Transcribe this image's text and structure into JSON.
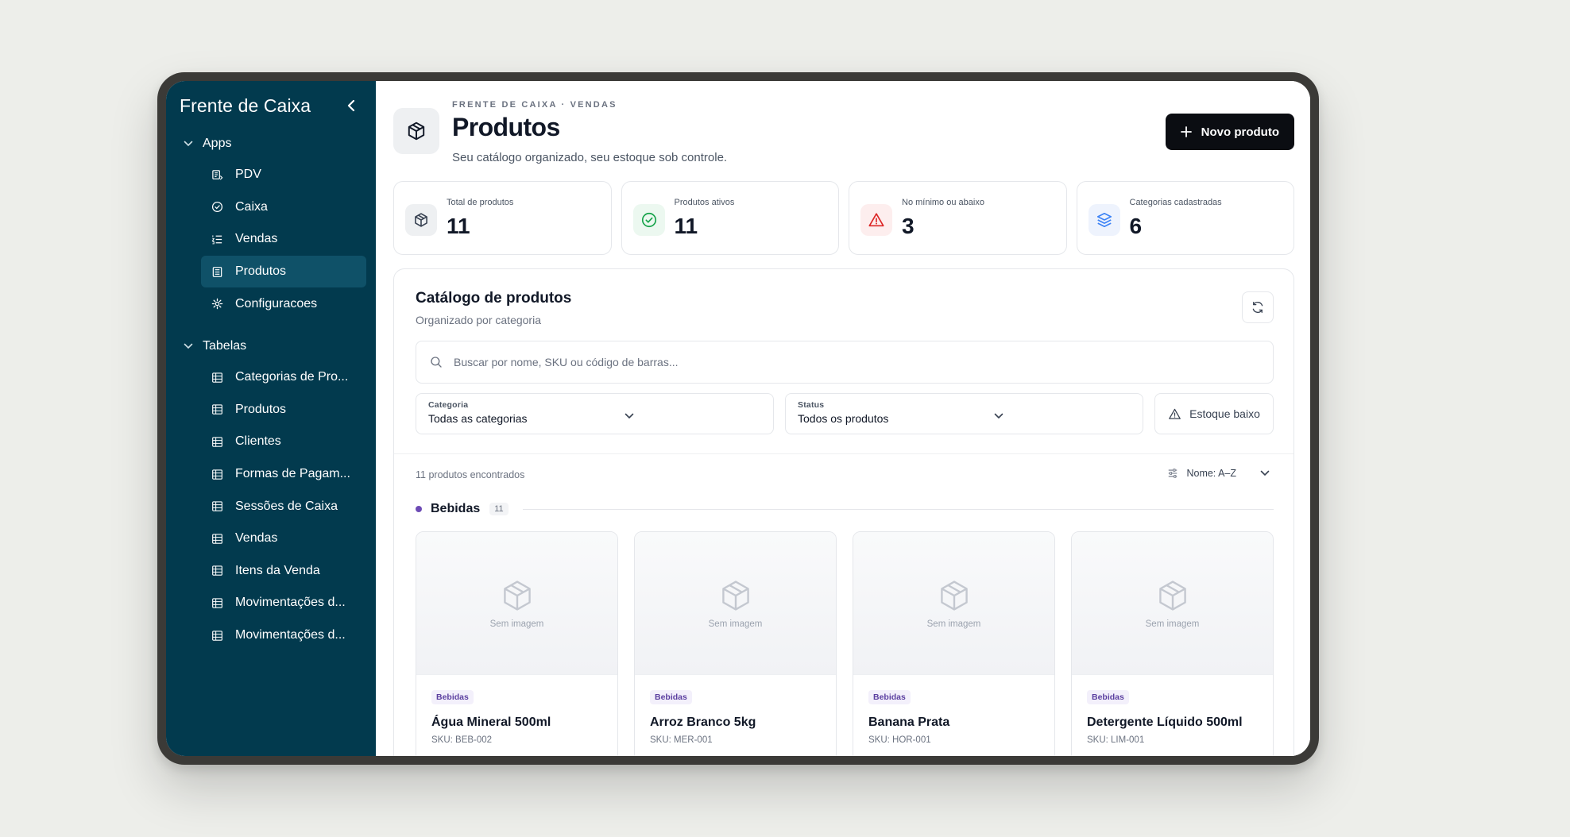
{
  "sidebar": {
    "brand": "Frente de Caixa",
    "groups": [
      {
        "label": "Apps",
        "items": [
          {
            "label": "PDV",
            "icon": "receipt-icon"
          },
          {
            "label": "Caixa",
            "icon": "check-circle-icon"
          },
          {
            "label": "Vendas",
            "icon": "list-ordered-icon"
          },
          {
            "label": "Produtos",
            "icon": "document-list-icon",
            "active": true
          },
          {
            "label": "Configuracoes",
            "icon": "gear-icon"
          }
        ]
      },
      {
        "label": "Tabelas",
        "items": [
          {
            "label": "Categorias de Pro...",
            "icon": "table-icon"
          },
          {
            "label": "Produtos",
            "icon": "table-icon"
          },
          {
            "label": "Clientes",
            "icon": "table-icon"
          },
          {
            "label": "Formas de Pagam...",
            "icon": "table-icon"
          },
          {
            "label": "Sessões de Caixa",
            "icon": "table-icon"
          },
          {
            "label": "Vendas",
            "icon": "table-icon"
          },
          {
            "label": "Itens da Venda",
            "icon": "table-icon"
          },
          {
            "label": "Movimentações d...",
            "icon": "table-icon"
          },
          {
            "label": "Movimentações d...",
            "icon": "table-icon"
          }
        ]
      }
    ]
  },
  "header": {
    "eyebrow": "FRENTE DE CAIXA · VENDAS",
    "title": "Produtos",
    "subtitle": "Seu catálogo organizado, seu estoque sob controle.",
    "new_button": "Novo produto"
  },
  "stats": [
    {
      "label": "Total de produtos",
      "value": "11",
      "icon": "package-icon",
      "color": "#374151",
      "bg": "#eef0f2"
    },
    {
      "label": "Produtos ativos",
      "value": "11",
      "icon": "check-circle-icon",
      "color": "#16a34a",
      "bg": "#ecf8f0"
    },
    {
      "label": "No mínimo ou abaixo",
      "value": "3",
      "icon": "warning-icon",
      "color": "#dc2626",
      "bg": "#fdeeee"
    },
    {
      "label": "Categorias cadastradas",
      "value": "6",
      "icon": "layers-icon",
      "color": "#3b82f6",
      "bg": "#eef3fd"
    }
  ],
  "catalog": {
    "title": "Catálogo de produtos",
    "subtitle": "Organizado por categoria",
    "search_placeholder": "Buscar por nome, SKU ou código de barras...",
    "filters": {
      "category_label": "Categoria",
      "category_value": "Todas as categorias",
      "status_label": "Status",
      "status_value": "Todos os produtos",
      "low_stock_button": "Estoque baixo"
    },
    "count_text": "11 produtos encontrados",
    "sort_text": "Nome: A–Z",
    "group": {
      "name": "Bebidas",
      "count": "11",
      "color": "#6d4bb5"
    },
    "no_image_text": "Sem imagem",
    "products": [
      {
        "category": "Bebidas",
        "name": "Água Mineral 500ml",
        "sku": "SKU: BEB-002"
      },
      {
        "category": "Bebidas",
        "name": "Arroz Branco 5kg",
        "sku": "SKU: MER-001"
      },
      {
        "category": "Bebidas",
        "name": "Banana Prata",
        "sku": "SKU: HOR-001"
      },
      {
        "category": "Bebidas",
        "name": "Detergente Líquido 500ml",
        "sku": "SKU: LIM-001"
      }
    ]
  }
}
